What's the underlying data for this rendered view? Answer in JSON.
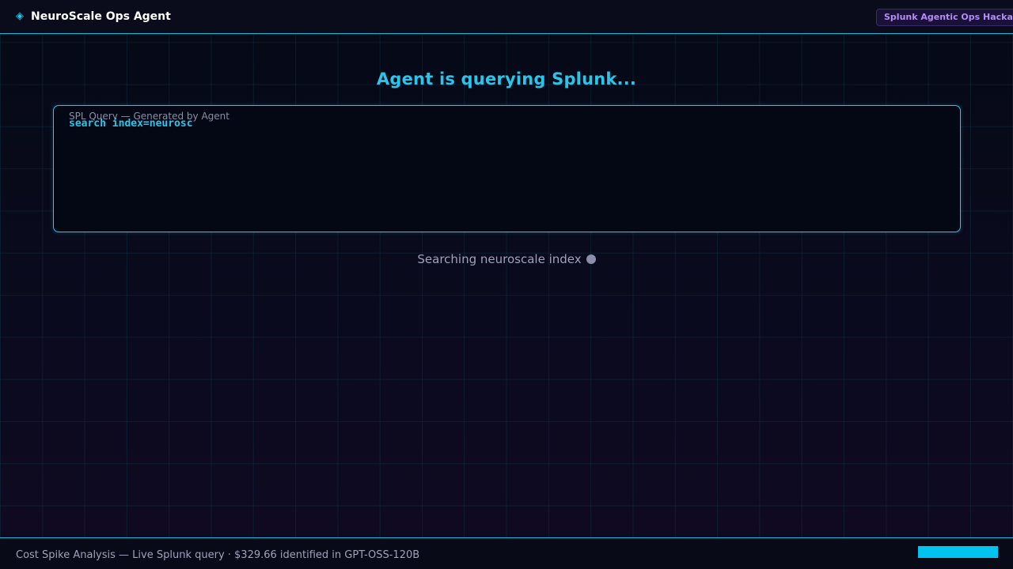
{
  "header": {
    "icon": "diamond-icon",
    "title": "NeuroScale Ops Agent",
    "badge": "Splunk Agentic Ops Hackathon"
  },
  "main": {
    "heading": "Agent is querying Splunk...",
    "query_label": "SPL Query — Generated by Agent",
    "query_text": "search index=neurosc",
    "status_text": "Searching neuroscale index"
  },
  "footer": {
    "caption": "Cost Spike Analysis — Live Splunk query · $329.66 identified in GPT-OSS-120B",
    "progress_fraction": 1.0
  },
  "colors": {
    "accent": "#27c6ea",
    "badge_text": "#b48cf5",
    "progress": "#00c4ef"
  }
}
